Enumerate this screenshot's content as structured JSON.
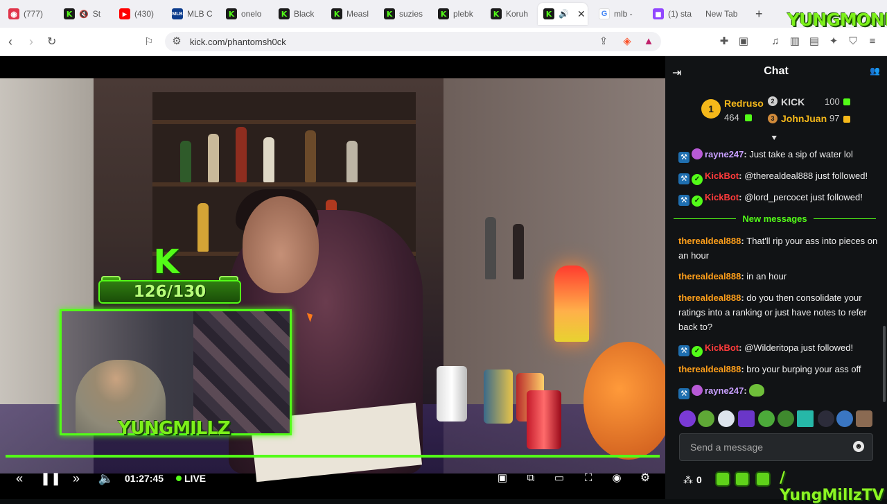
{
  "tabs": [
    {
      "label": "(777)",
      "icon": "red-badge-icon"
    },
    {
      "label": "St",
      "icon": "kick-icon"
    },
    {
      "label": "(430)",
      "icon": "youtube-icon"
    },
    {
      "label": "MLB C",
      "icon": "mlb-icon"
    },
    {
      "label": "onelo",
      "icon": "kick-icon"
    },
    {
      "label": "Black",
      "icon": "kick-icon"
    },
    {
      "label": "Measl",
      "icon": "kick-icon"
    },
    {
      "label": "suzies",
      "icon": "kick-icon"
    },
    {
      "label": "plebk",
      "icon": "kick-icon"
    },
    {
      "label": "Koruh",
      "icon": "kick-icon"
    },
    {
      "label": "",
      "icon": "kick-icon",
      "active": true
    },
    {
      "label": "mlb -",
      "icon": "google-icon"
    },
    {
      "label": "(1) sta",
      "icon": "twitch-icon"
    },
    {
      "label": "New Tab",
      "icon": ""
    }
  ],
  "brand_overlay": "YUNGMONEY",
  "address": {
    "url": "kick.com/phantomsh0ck"
  },
  "video": {
    "goal_letter": "K",
    "goal_progress": "126/130",
    "cam_name": "YUNGMILLZ",
    "timecode": "01:27:45",
    "live_label": "LIVE",
    "progress_fraction": 1.0
  },
  "chat": {
    "title": "Chat",
    "leaderboard": [
      {
        "rank": "1",
        "name": "Redruso",
        "value": "464"
      },
      {
        "rank": "2",
        "name": "KICK",
        "value": "100"
      },
      {
        "rank": "3",
        "name": "JohnJuan",
        "value": "97"
      }
    ],
    "messages": [
      {
        "user": "rayne247",
        "text": "Just take a sip of water lol",
        "style": "white",
        "badges": [
          "bot",
          "avatar"
        ]
      },
      {
        "user": "KickBot",
        "text": "@therealdeal888 just followed!",
        "style": "bot",
        "badges": [
          "bot",
          "verify"
        ]
      },
      {
        "user": "KickBot",
        "text": "@lord_percocet just followed!",
        "style": "bot",
        "badges": [
          "bot",
          "verify"
        ]
      }
    ],
    "new_messages_label": "New messages",
    "messages_after": [
      {
        "user": "therealdeal888",
        "text": "That'll rip your ass into pieces on an hour",
        "style": "orange"
      },
      {
        "user": "therealdeal888",
        "text": "in an hour",
        "style": "orange"
      },
      {
        "user": "therealdeal888",
        "text": "do you then consolidate your ratings into a ranking or just have notes to refer back to?",
        "style": "orange"
      },
      {
        "user": "KickBot",
        "text": "@Wilderitopa just followed!",
        "style": "bot",
        "badges": [
          "bot",
          "verify"
        ]
      },
      {
        "user": "therealdeal888",
        "text": "bro your burping your ass off",
        "style": "orange"
      },
      {
        "user": "rayne247",
        "text": "",
        "style": "white",
        "badges": [
          "bot",
          "avatar"
        ],
        "emote": "frog-emote"
      }
    ],
    "input_placeholder": "Send a message",
    "points": "0",
    "social_handle": "/ YungMillzTV"
  },
  "colors": {
    "kick_green": "#53fc18",
    "bot_red": "#ff3b3b",
    "user_orange": "#ff9f1a"
  }
}
